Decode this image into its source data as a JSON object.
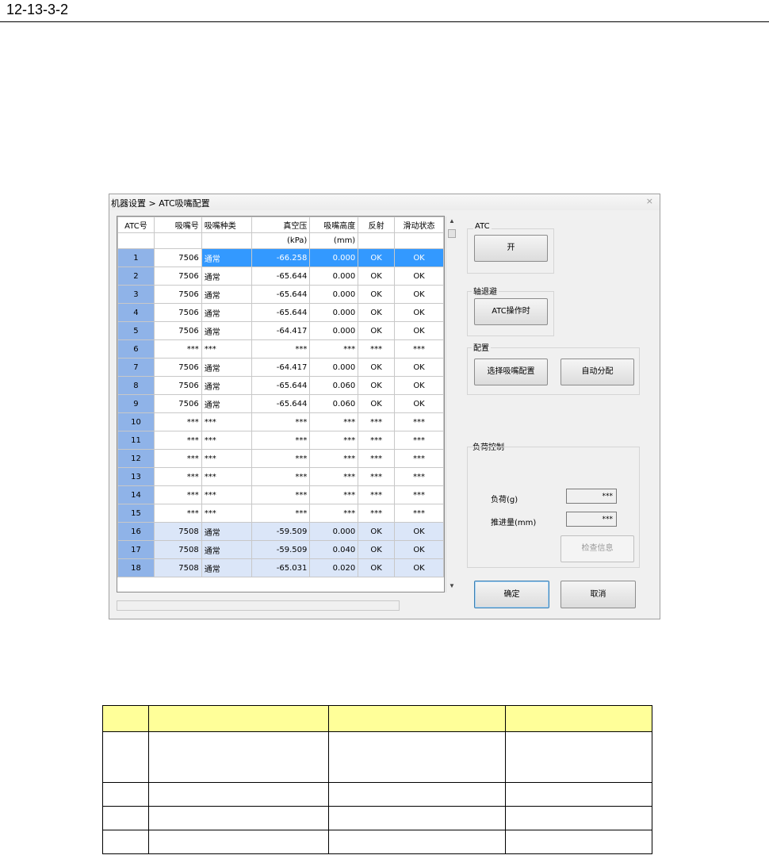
{
  "doc": {
    "section": "12-13-3-2"
  },
  "window": {
    "title": "机器设置 > ATC吸嘴配置",
    "close": "×"
  },
  "grid": {
    "headers": [
      "ATC号",
      "吸嘴号",
      "吸嘴种类",
      "真空压",
      "吸嘴高度",
      "反射",
      "滑动状态"
    ],
    "units": [
      "",
      "",
      "",
      "(kPa)",
      "(mm)",
      "",
      ""
    ],
    "rows": [
      [
        "1",
        "7506",
        "通常",
        "-66.258",
        "0.000",
        "OK",
        "OK"
      ],
      [
        "2",
        "7506",
        "通常",
        "-65.644",
        "0.000",
        "OK",
        "OK"
      ],
      [
        "3",
        "7506",
        "通常",
        "-65.644",
        "0.000",
        "OK",
        "OK"
      ],
      [
        "4",
        "7506",
        "通常",
        "-65.644",
        "0.000",
        "OK",
        "OK"
      ],
      [
        "5",
        "7506",
        "通常",
        "-64.417",
        "0.000",
        "OK",
        "OK"
      ],
      [
        "6",
        "***",
        "***",
        "***",
        "***",
        "***",
        "***"
      ],
      [
        "7",
        "7506",
        "通常",
        "-64.417",
        "0.000",
        "OK",
        "OK"
      ],
      [
        "8",
        "7506",
        "通常",
        "-65.644",
        "0.060",
        "OK",
        "OK"
      ],
      [
        "9",
        "7506",
        "通常",
        "-65.644",
        "0.060",
        "OK",
        "OK"
      ],
      [
        "10",
        "***",
        "***",
        "***",
        "***",
        "***",
        "***"
      ],
      [
        "11",
        "***",
        "***",
        "***",
        "***",
        "***",
        "***"
      ],
      [
        "12",
        "***",
        "***",
        "***",
        "***",
        "***",
        "***"
      ],
      [
        "13",
        "***",
        "***",
        "***",
        "***",
        "***",
        "***"
      ],
      [
        "14",
        "***",
        "***",
        "***",
        "***",
        "***",
        "***"
      ],
      [
        "15",
        "***",
        "***",
        "***",
        "***",
        "***",
        "***"
      ],
      [
        "16",
        "7508",
        "通常",
        "-59.509",
        "0.000",
        "OK",
        "OK"
      ],
      [
        "17",
        "7508",
        "通常",
        "-59.509",
        "0.040",
        "OK",
        "OK"
      ],
      [
        "18",
        "7508",
        "通常",
        "-65.031",
        "0.020",
        "OK",
        "OK"
      ]
    ],
    "selected_row": 0,
    "alt_rows": [
      15,
      16,
      17
    ]
  },
  "atc_group": {
    "label": "ATC",
    "button": "开"
  },
  "axis_group": {
    "label": "轴退避",
    "button": "ATC操作时"
  },
  "config_group": {
    "label": "配置",
    "select_button": "选择吸嘴配置",
    "auto_button": "自动分配"
  },
  "load_group": {
    "label": "负荷控制",
    "load_label": "负荷(g)",
    "load_value": "***",
    "push_label": "推进量(mm)",
    "push_value": "***",
    "check_button": "检查信息"
  },
  "footer": {
    "ok": "确定",
    "cancel": "取消"
  },
  "icons": {
    "scroll_up": "▲",
    "scroll_down": "▼"
  },
  "colors": {
    "row_number_bg": "#8fb3e8",
    "selected_bg": "#3399ff",
    "alt_bg": "#dbe6f8",
    "table_header": "#ffff99"
  }
}
